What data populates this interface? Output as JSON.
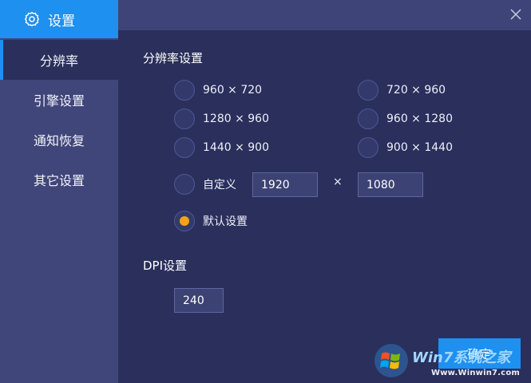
{
  "sidebar": {
    "header": {
      "icon": "gear-icon",
      "title": "设置"
    },
    "items": [
      {
        "label": "分辨率",
        "active": true
      },
      {
        "label": "引擎设置",
        "active": false
      },
      {
        "label": "通知恢复",
        "active": false
      },
      {
        "label": "其它设置",
        "active": false
      }
    ]
  },
  "window": {
    "close_icon": "close-icon"
  },
  "resolution": {
    "title": "分辨率设置",
    "options": [
      {
        "label": "960 × 720",
        "checked": false
      },
      {
        "label": "720 × 960",
        "checked": false
      },
      {
        "label": "1280 × 960",
        "checked": false
      },
      {
        "label": "960 × 1280",
        "checked": false
      },
      {
        "label": "1440 × 900",
        "checked": false
      },
      {
        "label": "900 × 1440",
        "checked": false
      }
    ],
    "custom": {
      "label": "自定义",
      "width": "1920",
      "separator": "×",
      "height": "1080",
      "checked": false
    },
    "default": {
      "label": "默认设置",
      "checked": true
    }
  },
  "dpi": {
    "title": "DPI设置",
    "value": "240"
  },
  "footer": {
    "confirm_label": "确定"
  },
  "watermark": {
    "brand": "Win7系统之家",
    "url": "Www.Winwin7.com"
  },
  "colors": {
    "accent": "#1e90f0",
    "selected_dot": "#f7a11b",
    "background": "#2a2f5c",
    "sidebar": "#40457a"
  }
}
